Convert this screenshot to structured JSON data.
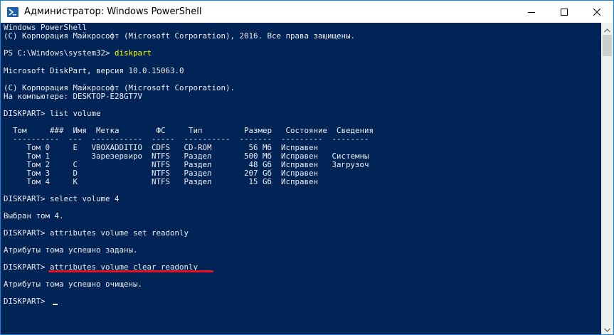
{
  "window": {
    "title": "Администратор: Windows PowerShell",
    "icon": "powershell-icon",
    "controls": [
      "minimize-icon",
      "maximize-icon",
      "close-icon"
    ]
  },
  "console": {
    "lines": [
      {
        "text": "Windows PowerShell"
      },
      {
        "text": "(C) Корпорация Майкрософт (Microsoft Corporation), 2016. Все права защищены."
      },
      {
        "text": ""
      },
      {
        "prompt": "PS C:\\Windows\\system32> ",
        "command": "diskpart"
      },
      {
        "text": ""
      },
      {
        "text": "Microsoft DiskPart, версия 10.0.15063.0"
      },
      {
        "text": ""
      },
      {
        "text": "(C) Корпорация Майкрософт (Microsoft Corporation)."
      },
      {
        "text": "На компьютере: DESKTOP-E28GT7V"
      },
      {
        "text": ""
      },
      {
        "text": "DISKPART> list volume"
      },
      {
        "text": ""
      },
      {
        "text": "  Том     ###  Имя  Метка        ФС     Тип         Размер   Состояние  Сведения"
      },
      {
        "text": "  ----------  ---  -----------  -----  ----------  -------  ---------  --------"
      },
      {
        "text": "     Том 0     E   VBOXADDITIO  CDFS   CD-ROM        56 Мб  Исправен"
      },
      {
        "text": "     Том 1         Зарезервиро  NTFS   Раздел       500 Мб  Исправен   Системны"
      },
      {
        "text": "     Том 2     C                NTFS   Раздел        48 Gб  Исправен   Загрузоч"
      },
      {
        "text": "     Том 3     D                NTFS   Раздел       207 Gб  Исправен"
      },
      {
        "text": "     Том 4     K                NTFS   Раздел        15 Gб  Исправен"
      },
      {
        "text": ""
      },
      {
        "text": "DISKPART> select volume 4"
      },
      {
        "text": ""
      },
      {
        "text": "Выбран том 4."
      },
      {
        "text": ""
      },
      {
        "text": "DISKPART> attributes volume set readonly"
      },
      {
        "text": ""
      },
      {
        "text": "Атрибуты тома успешно заданы."
      },
      {
        "text": ""
      },
      {
        "text": "DISKPART> attributes volume clear readonly"
      },
      {
        "text": ""
      },
      {
        "text": "Атрибуты тома успешно очищены."
      },
      {
        "text": ""
      },
      {
        "text": "DISKPART> "
      }
    ],
    "colors": {
      "background": "#012456",
      "text": "#eeedf0",
      "command": "#ffff00",
      "annotation": "#e8111d"
    }
  },
  "scrollbar": {
    "icons": [
      "scroll-up-icon",
      "scroll-down-icon"
    ]
  }
}
